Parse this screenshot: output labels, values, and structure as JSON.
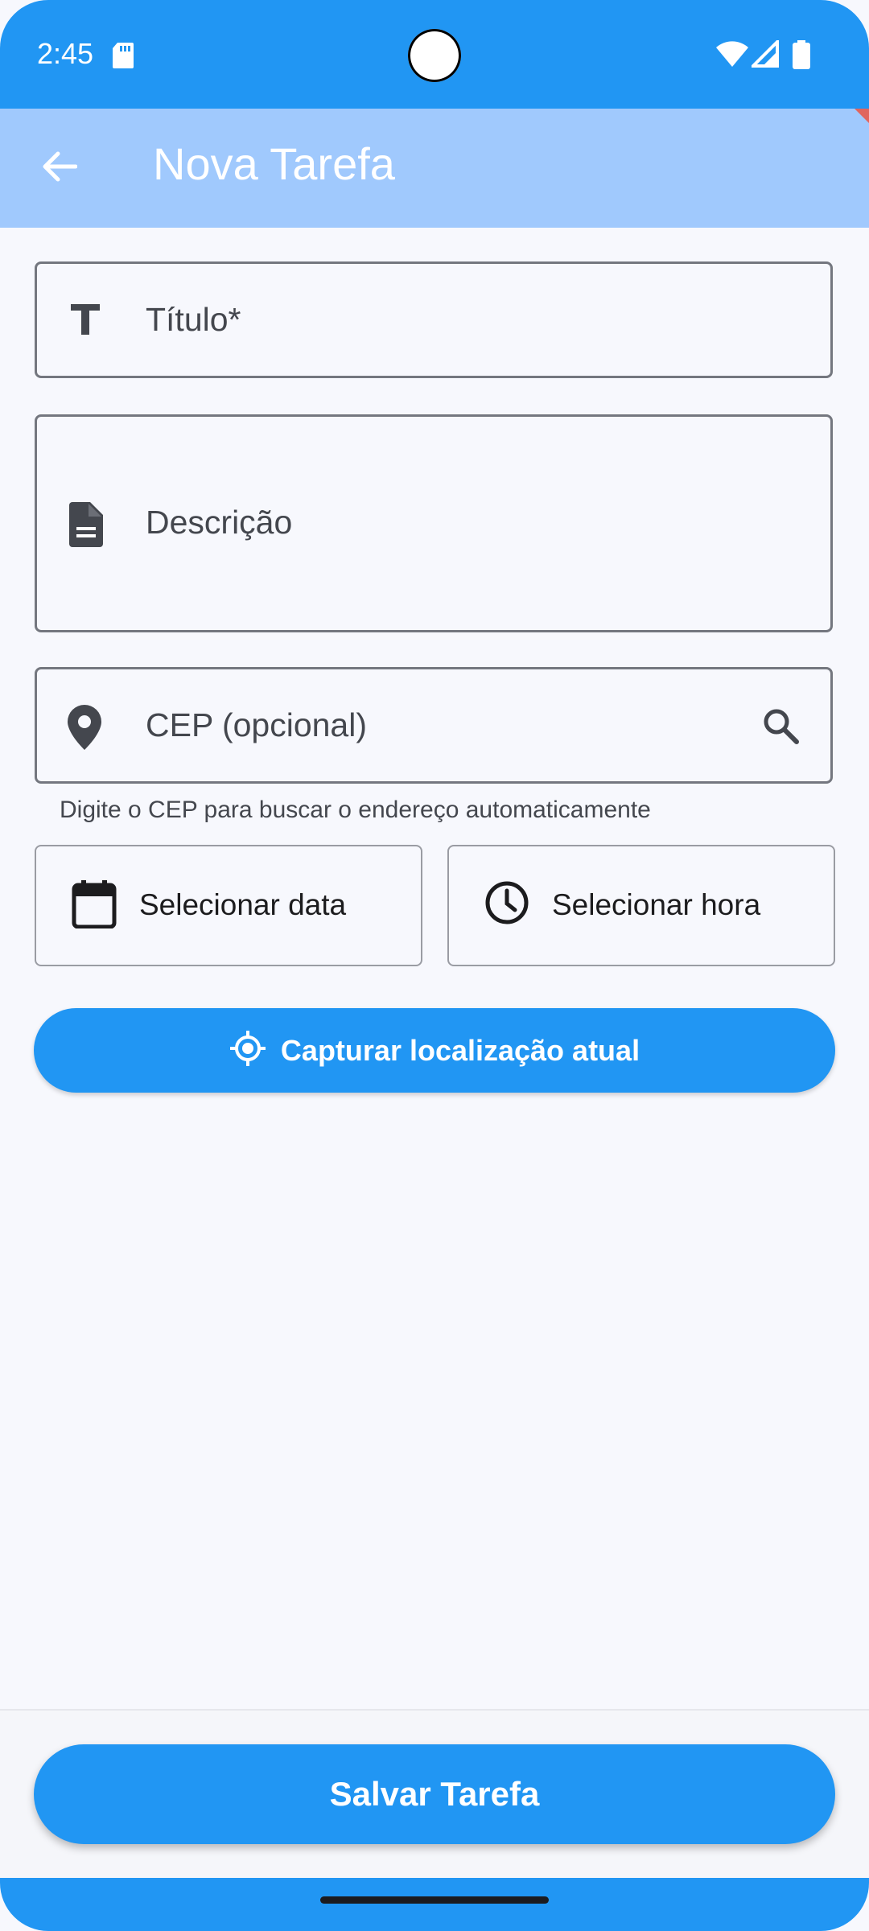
{
  "status_bar": {
    "time": "2:45",
    "icons": [
      "sd-card-icon",
      "wifi-icon",
      "signal-icon",
      "battery-icon"
    ]
  },
  "app_bar": {
    "title": "Nova Tarefa",
    "back_icon": "arrow-back-icon"
  },
  "form": {
    "title_field": {
      "label": "Título*",
      "icon": "title-icon"
    },
    "description_field": {
      "label": "Descrição",
      "icon": "description-icon"
    },
    "cep_field": {
      "label": "CEP (opcional)",
      "icon": "location-pin-icon",
      "action_icon": "search-icon",
      "helper": "Digite o CEP para buscar o endereço automaticamente"
    },
    "date_button": {
      "label": "Selecionar data",
      "icon": "calendar-icon"
    },
    "time_button": {
      "label": "Selecionar hora",
      "icon": "clock-icon"
    },
    "capture_button": {
      "label": "Capturar localização atual",
      "icon": "my-location-icon"
    }
  },
  "footer": {
    "save_label": "Salvar Tarefa"
  },
  "colors": {
    "primary": "#2196f3",
    "app_bar": "#a0c9fd",
    "background": "#f7f8fd",
    "outline": "#74777f"
  }
}
